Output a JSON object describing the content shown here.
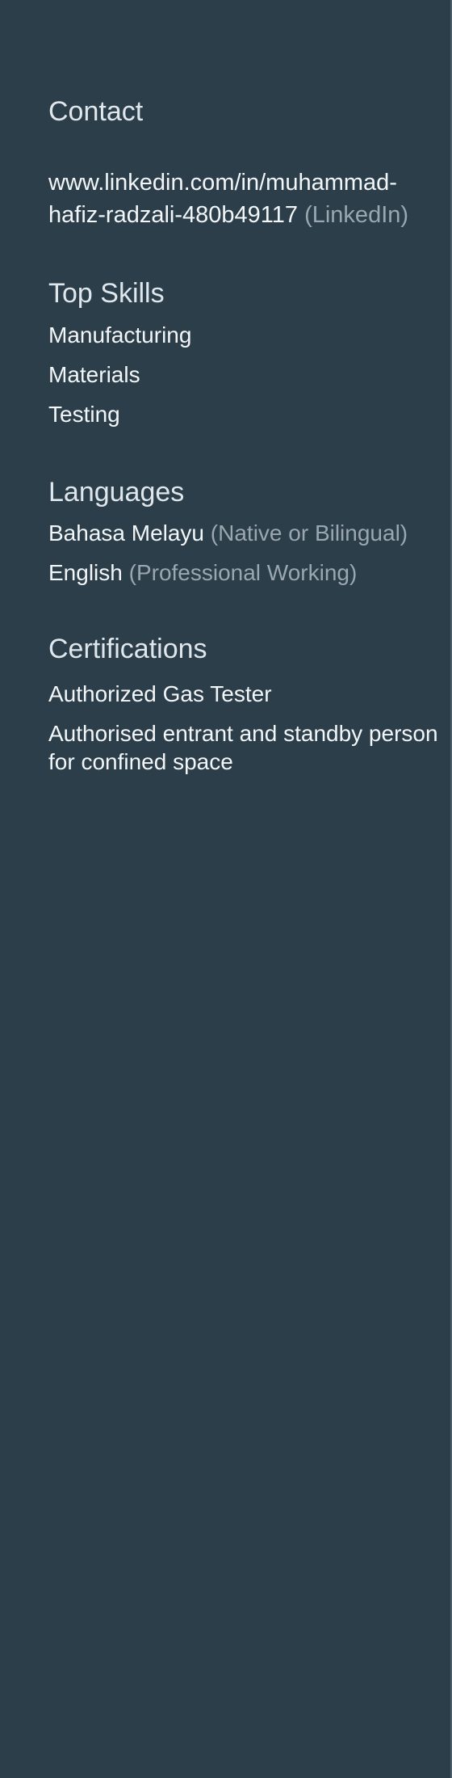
{
  "contact": {
    "heading": "Contact",
    "linkedin_url": "www.linkedin.com/in/muhammad-hafiz-radzali-480b49117",
    "linkedin_label": "(LinkedIn)"
  },
  "top_skills": {
    "heading": "Top Skills",
    "items": [
      "Manufacturing",
      "Materials",
      "Testing"
    ]
  },
  "languages": {
    "heading": "Languages",
    "items": [
      {
        "name": "Bahasa Melayu",
        "level": "(Native or Bilingual)"
      },
      {
        "name": "English",
        "level": "(Professional Working)"
      }
    ]
  },
  "certifications": {
    "heading": "Certifications",
    "items": [
      "Authorized Gas Tester",
      "Authorised entrant and standby person for confined space"
    ]
  },
  "colors": {
    "background": "#2c3e4a",
    "heading": "#dfe7ec",
    "text": "#f2f6f8",
    "muted": "#9aa7b0"
  }
}
